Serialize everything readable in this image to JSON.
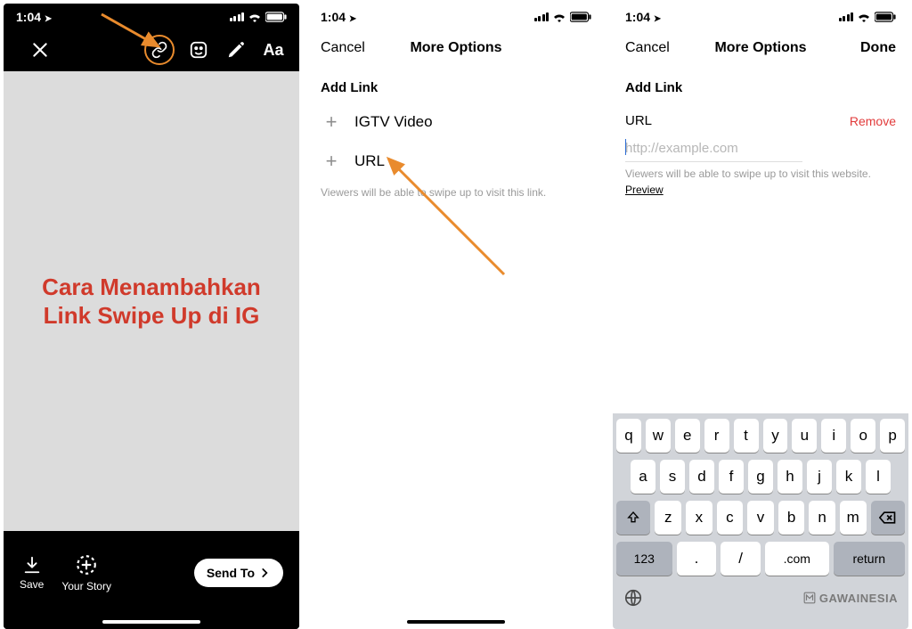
{
  "status": {
    "time": "1:04",
    "loc_arrow": "➤"
  },
  "p1": {
    "caption": "Cara Menambahkan\nLink Swipe Up di IG",
    "save": "Save",
    "your_story": "Your Story",
    "send_to": "Send To"
  },
  "p2": {
    "cancel": "Cancel",
    "title": "More Options",
    "section": "Add Link",
    "opt1": "IGTV Video",
    "opt2": "URL",
    "hint": "Viewers will be able to swipe up to visit this link."
  },
  "p3": {
    "cancel": "Cancel",
    "title": "More Options",
    "done": "Done",
    "section": "Add Link",
    "url_label": "URL",
    "remove": "Remove",
    "placeholder": "http://example.com",
    "hint": "Viewers will be able to swipe up to visit this website.",
    "preview": "Preview",
    "rows": {
      "r1": [
        "q",
        "w",
        "e",
        "r",
        "t",
        "y",
        "u",
        "i",
        "o",
        "p"
      ],
      "r2": [
        "a",
        "s",
        "d",
        "f",
        "g",
        "h",
        "j",
        "k",
        "l"
      ],
      "r3": [
        "z",
        "x",
        "c",
        "v",
        "b",
        "n",
        "m"
      ],
      "r4_123": "123",
      "r4_dot": ".",
      "r4_slash": "/",
      "r4_com": ".com",
      "r4_return": "return"
    },
    "watermark": "GAWAINESIA"
  }
}
